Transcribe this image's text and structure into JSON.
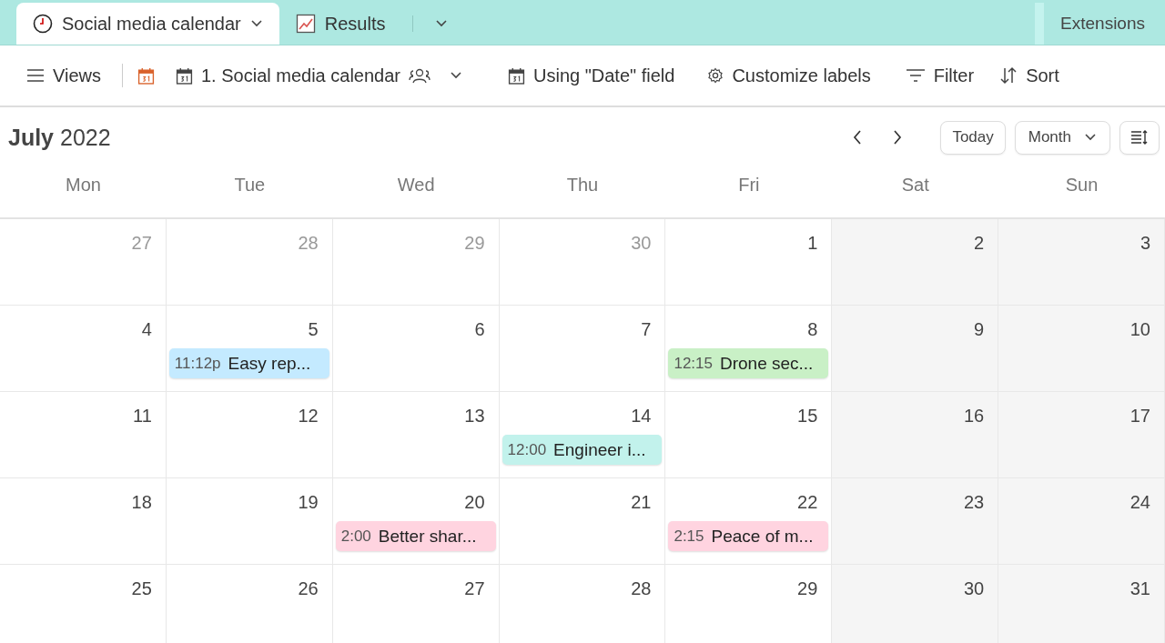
{
  "tabs": [
    {
      "kind": "clock",
      "label": "Social media calendar",
      "selected": true
    },
    {
      "kind": "chart",
      "label": "Results",
      "selected": false
    }
  ],
  "extensions": "Extensions",
  "toolbar": {
    "views": "Views",
    "calendar_name": "1. Social media calendar",
    "date_field": "Using \"Date\" field",
    "customize": "Customize labels",
    "filter": "Filter",
    "sort": "Sort"
  },
  "calendar": {
    "month": "July",
    "year": "2022",
    "today": "Today",
    "range": "Month",
    "weekdays": [
      "Mon",
      "Tue",
      "Wed",
      "Thu",
      "Fri",
      "Sat",
      "Sun"
    ],
    "weeks": [
      {
        "days": [
          {
            "label": "27",
            "in_month": false
          },
          {
            "label": "28",
            "in_month": false
          },
          {
            "label": "29",
            "in_month": false
          },
          {
            "label": "30",
            "in_month": false
          },
          {
            "label": "1",
            "in_month": true
          },
          {
            "label": "2",
            "in_month": true
          },
          {
            "label": "3",
            "in_month": true
          }
        ]
      },
      {
        "days": [
          {
            "label": "4",
            "in_month": true
          },
          {
            "label": "5",
            "in_month": true,
            "events": [
              {
                "time": "11:12p",
                "title": "Easy rep...",
                "color": "#c4eaff"
              }
            ]
          },
          {
            "label": "6",
            "in_month": true
          },
          {
            "label": "7",
            "in_month": true
          },
          {
            "label": "8",
            "in_month": true,
            "events": [
              {
                "time": "12:15",
                "title": "Drone sec...",
                "color": "#c9f0c6"
              }
            ]
          },
          {
            "label": "9",
            "in_month": true
          },
          {
            "label": "10",
            "in_month": true
          }
        ]
      },
      {
        "days": [
          {
            "label": "11",
            "in_month": true
          },
          {
            "label": "12",
            "in_month": true
          },
          {
            "label": "13",
            "in_month": true
          },
          {
            "label": "14",
            "in_month": true,
            "events": [
              {
                "time": "12:00",
                "title": "Engineer i...",
                "color": "#c2f2ec"
              }
            ]
          },
          {
            "label": "15",
            "in_month": true
          },
          {
            "label": "16",
            "in_month": true
          },
          {
            "label": "17",
            "in_month": true
          }
        ]
      },
      {
        "days": [
          {
            "label": "18",
            "in_month": true
          },
          {
            "label": "19",
            "in_month": true
          },
          {
            "label": "20",
            "in_month": true,
            "events": [
              {
                "time": "2:00",
                "title": "Better shar...",
                "color": "#ffd4e0"
              }
            ]
          },
          {
            "label": "21",
            "in_month": true
          },
          {
            "label": "22",
            "in_month": true,
            "events": [
              {
                "time": "2:15",
                "title": "Peace of m...",
                "color": "#ffd4e0"
              }
            ]
          },
          {
            "label": "23",
            "in_month": true
          },
          {
            "label": "24",
            "in_month": true
          }
        ]
      },
      {
        "days": [
          {
            "label": "25",
            "in_month": true
          },
          {
            "label": "26",
            "in_month": true
          },
          {
            "label": "27",
            "in_month": true
          },
          {
            "label": "28",
            "in_month": true
          },
          {
            "label": "29",
            "in_month": true
          },
          {
            "label": "30",
            "in_month": true
          },
          {
            "label": "31",
            "in_month": true
          }
        ]
      }
    ]
  }
}
